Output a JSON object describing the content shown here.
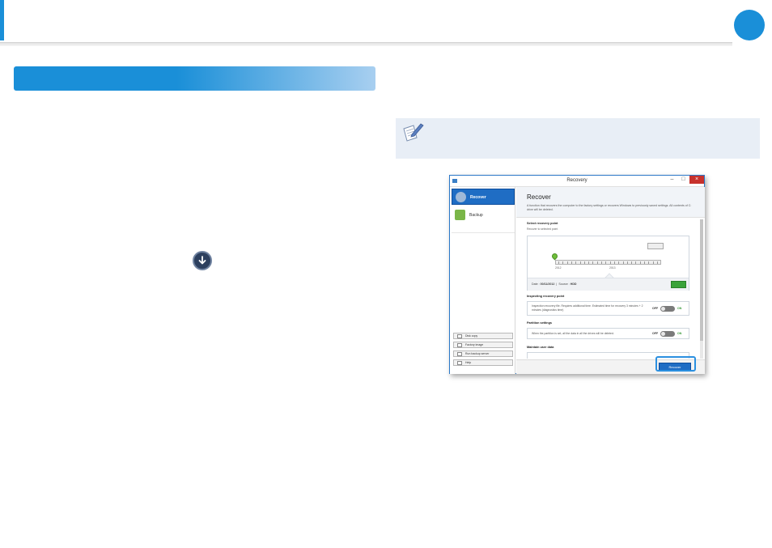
{
  "colors": {
    "accent": "#1a8fd8",
    "note_bg": "#e8eef6",
    "window_blue": "#1f6dc4",
    "green": "#6fbf3a"
  },
  "icons": {
    "arrow": "circle-arrow-down-icon",
    "note": "note-pencil-icon"
  },
  "window": {
    "title": "Recovery",
    "controls": [
      "–",
      "□",
      "×"
    ]
  },
  "sidebar": {
    "items": [
      {
        "label": "Recover",
        "active": true
      },
      {
        "label": "Backup",
        "active": false
      }
    ],
    "tools": [
      "Disk copy",
      "Factory image",
      "Run backup server",
      "Help"
    ]
  },
  "content": {
    "title": "Recover",
    "description": "A function that recovers the computer to the factory settings or recovers Windows to previously saved settings. All contents of C: drive will be deleted.",
    "recovery_point": {
      "title": "Select recovery point",
      "subtitle": "Recover to selected point",
      "years": [
        "2012",
        "2013"
      ],
      "date_label": "Date :",
      "date_value": "00/11/2012",
      "source_label": "Source :",
      "source_value": "HDD"
    },
    "options": [
      {
        "title": "Inspecting recovery point",
        "text": "Inspection recovery file. Requires additional time. Estimated time for recovery 3 minutes + 2 minutes (diagnostics time)",
        "off": "OFF",
        "on": "ON"
      },
      {
        "title": "Partition settings",
        "text": "When the partition is set, all the data in all the drives will be deleted.",
        "off": "OFF",
        "on": "ON"
      },
      {
        "title": "Maintain user data"
      }
    ],
    "recover_button": "Recover"
  }
}
